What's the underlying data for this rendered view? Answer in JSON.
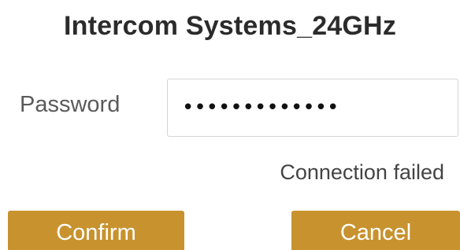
{
  "dialog": {
    "title": "Intercom Systems_24GHz"
  },
  "password": {
    "label": "Password",
    "masked_value": "•••••••••••••"
  },
  "status": {
    "message": "Connection failed"
  },
  "buttons": {
    "confirm_label": "Confirm",
    "cancel_label": "Cancel"
  },
  "colors": {
    "button_accent": "#c8922e",
    "title_text": "#2b2b2b",
    "label_text": "#5a5a5a"
  }
}
